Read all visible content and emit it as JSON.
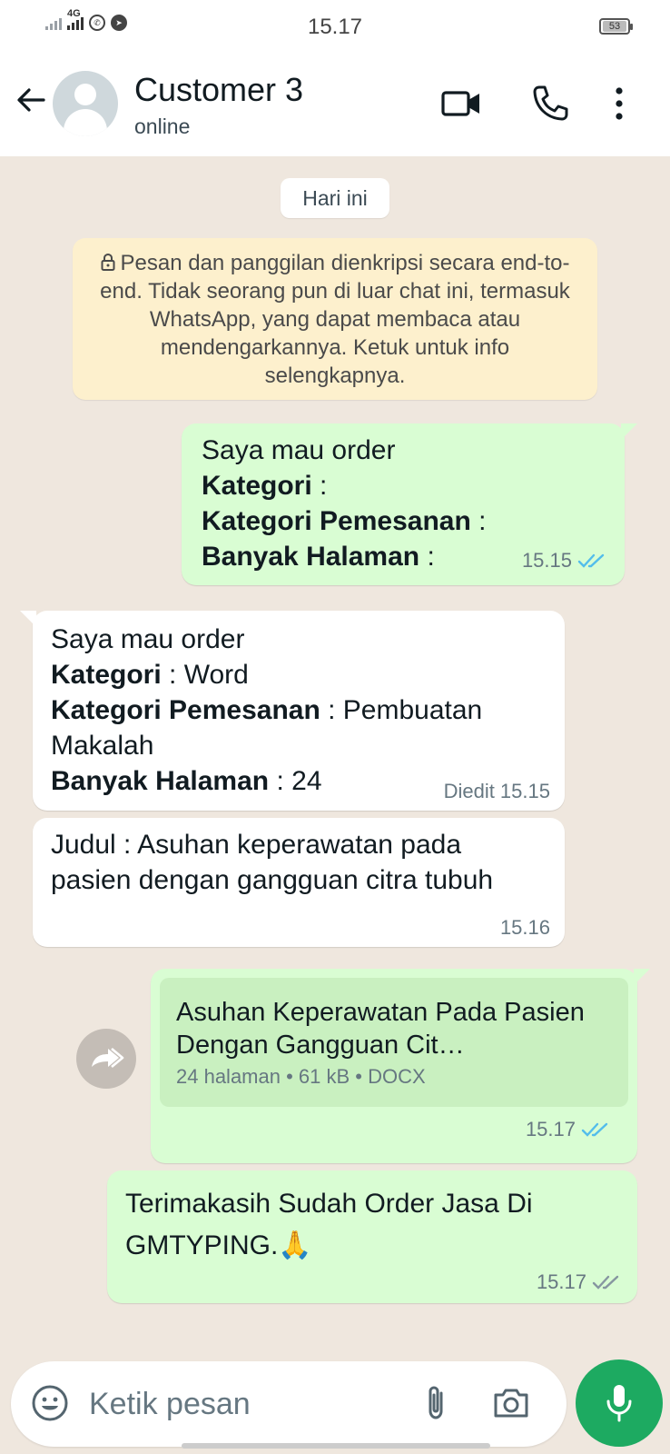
{
  "status_bar": {
    "network": "4G",
    "time": "15.17",
    "battery": "53"
  },
  "header": {
    "contact_name": "Customer 3",
    "contact_status": "online"
  },
  "chat": {
    "date_chip": "Hari ini",
    "encryption_notice": "Pesan dan panggilan dienkripsi secara end-to-end. Tidak seorang pun di luar chat ini, termasuk WhatsApp, yang dapat membaca atau mendengarkannya. Ketuk untuk info selengkapnya.",
    "messages": [
      {
        "direction": "outgoing",
        "line1": "Saya mau order",
        "k1": "Kategori",
        "v1": "",
        "k2": "Kategori Pemesanan",
        "v2": "",
        "k3": "Banyak Halaman",
        "v3": "",
        "time": "15.15",
        "status": "read"
      },
      {
        "direction": "incoming",
        "line1": "Saya mau order",
        "k1": "Kategori",
        "v1": "Word",
        "k2": "Kategori Pemesanan",
        "v2": "Pembuatan Makalah",
        "k3": "Banyak Halaman",
        "v3": "24",
        "time": "Diedit 15.15"
      },
      {
        "direction": "incoming",
        "text": "Judul : Asuhan keperawatan pada pasien dengan gangguan citra tubuh",
        "time": "15.16"
      },
      {
        "direction": "outgoing",
        "document": {
          "title": "Asuhan Keperawatan Pada Pasien Dengan Gangguan Cit…",
          "meta": "24 halaman • 61 kB • DOCX"
        },
        "time": "15.17",
        "status": "read"
      },
      {
        "direction": "outgoing",
        "text": "Terimakasih Sudah Order Jasa Di GMTYPING.🙏",
        "time": "15.17",
        "status": "delivered"
      }
    ]
  },
  "input": {
    "placeholder": "Ketik pesan"
  },
  "colors": {
    "outgoing_bubble": "#d9fdd3",
    "incoming_bubble": "#ffffff",
    "read_ticks": "#53bdeb",
    "delivered_ticks": "#8696a0",
    "mic_button": "#1daa61",
    "chat_background": "#efe7de",
    "encryption_banner": "#fdf0cd"
  },
  "icons": [
    "back-arrow-icon",
    "video-call-icon",
    "voice-call-icon",
    "more-options-icon",
    "lock-icon",
    "forward-icon",
    "emoji-icon",
    "attach-icon",
    "camera-icon",
    "mic-icon",
    "double-check-icon"
  ]
}
